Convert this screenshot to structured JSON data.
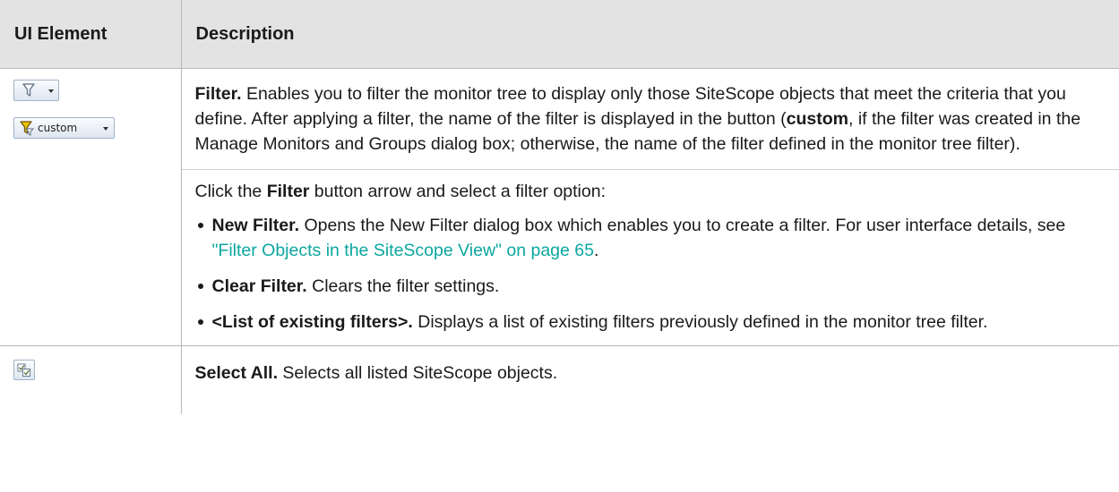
{
  "header": {
    "col1": "UI Element",
    "col2": "Description"
  },
  "rows": [
    {
      "icons": [
        "filter-icon",
        "filter-custom-icon"
      ],
      "custom_label": "custom",
      "p1": {
        "term": "Filter.",
        "text1": " Enables you to filter the monitor tree to display only those SiteScope objects that meet the criteria that you define. After applying a filter, the name of the filter is displayed in the button (",
        "bold": "custom",
        "text2": ", if the filter was created in the Manage Monitors and Groups dialog box; otherwise, the name of the filter defined in the monitor tree filter)."
      },
      "p2": {
        "text1": "Click the ",
        "bold": "Filter",
        "text2": " button arrow and select a filter option:"
      },
      "bullets": [
        {
          "term": "New Filter.",
          "text": " Opens the New Filter dialog box which enables you to create a filter. For user interface details, see ",
          "link": "\"Filter Objects in the SiteScope View\" on page 65",
          "after": "."
        },
        {
          "term": "Clear Filter.",
          "text": " Clears the filter settings."
        },
        {
          "term": "<List of existing filters>.",
          "text": " Displays a list of existing filters previously defined in the monitor tree filter."
        }
      ]
    },
    {
      "icons": [
        "select-all-icon"
      ],
      "term": "Select All.",
      "text": " Selects all listed SiteScope objects."
    }
  ],
  "colors": {
    "header_bg": "#e3e3e3",
    "link": "#0ba7a0",
    "border": "#b8b8b8"
  }
}
